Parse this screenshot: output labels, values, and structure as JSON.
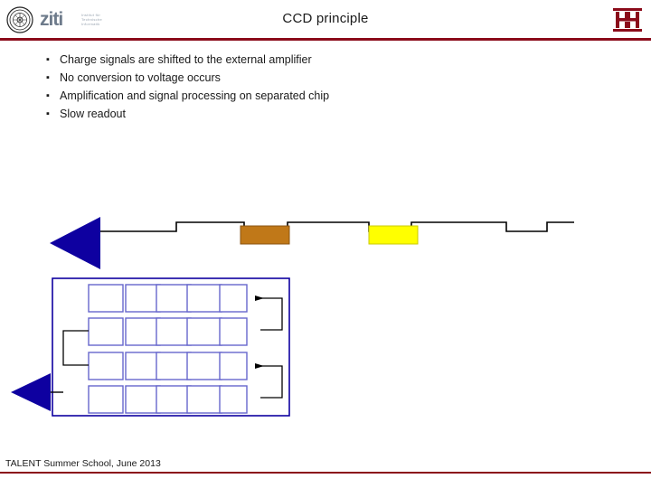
{
  "header": {
    "title": "CCD principle",
    "left_logo_name": "university-seal",
    "brand_text": "ziti",
    "brand_sub": "Institut für Technische Informatik",
    "right_logo_name": "uni-heidelberg-logo",
    "rule_color": "#8b0b1a"
  },
  "bullets": {
    "marker": "▪",
    "items": [
      "Charge signals are shifted to the external amplifier",
      "No conversion to voltage occurs",
      "Amplification and signal processing on separated chip",
      "Slow readout"
    ]
  },
  "diagram": {
    "arrow_color": "#0e00a0",
    "line_color": "#000000",
    "charge_packet_1_color": "#c07818",
    "charge_packet_2_color": "#ffff00",
    "pixel_fill": "#ffffff",
    "pixel_border": "#6666cc",
    "top_arrow_name": "readout-direction-arrow-top",
    "bottom_arrow_name": "readout-direction-arrow-bottom",
    "register_name": "shift-register-clock-waveform",
    "pixel_array_name": "ccd-pixel-array",
    "pixel_rows": 4,
    "pixel_cols": 5
  },
  "footer": {
    "text": "TALENT Summer School, June 2013",
    "rule_color": "#8b0b1a"
  }
}
